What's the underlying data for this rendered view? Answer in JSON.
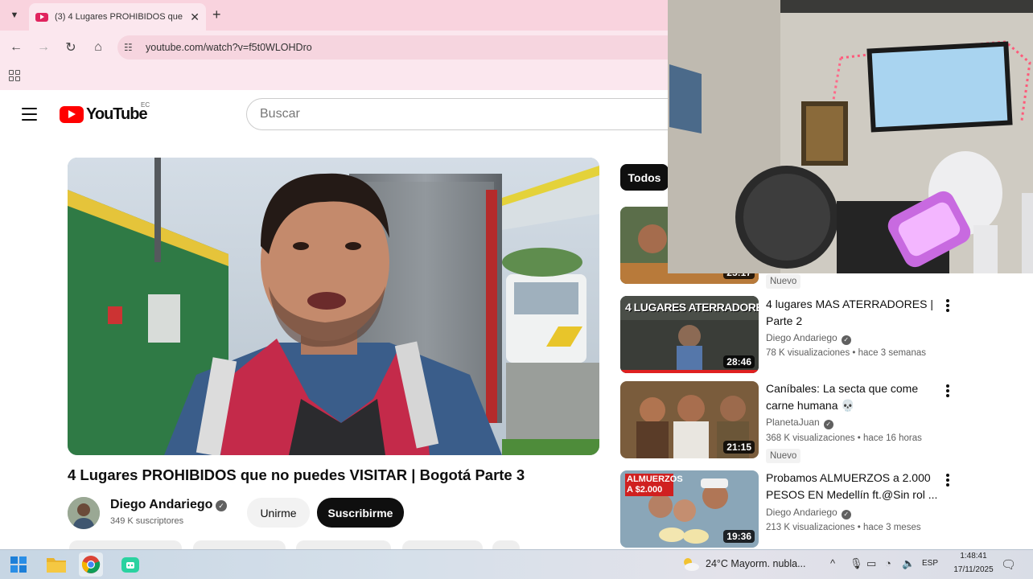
{
  "browser": {
    "tab_title": "(3) 4 Lugares PROHIBIDOS que",
    "tab_close": "✕",
    "new_tab": "+",
    "url": "youtube.com/watch?v=f5t0WLOHDro"
  },
  "youtube": {
    "logo_text": "YouTube",
    "country_code": "EC",
    "search_placeholder": "Buscar",
    "video": {
      "title": "4 Lugares PROHIBIDOS que no puedes VISITAR | Bogotá Parte 3",
      "channel": "Diego Andariego",
      "subscribers": "349 K suscriptores",
      "join_label": "Unirme",
      "subscribe_label": "Suscribirme"
    },
    "chip_all": "Todos",
    "recommendations": [
      {
        "duration": "25:17",
        "badge": "Nuevo"
      },
      {
        "thumb_text": "4 LUGARES ATERRADORES",
        "duration": "28:46",
        "title": "4 lugares MAS ATERRADORES | Parte 2",
        "channel": "Diego Andariego",
        "meta": "78 K visualizaciones • hace 3 semanas"
      },
      {
        "duration": "21:15",
        "title": "Caníbales: La secta que come carne humana 💀",
        "channel": "PlanetaJuan",
        "meta": "368 K visualizaciones • hace 16 horas",
        "badge": "Nuevo"
      },
      {
        "thumb_text": "ALMUERZOS A $2.000",
        "duration": "19:36",
        "title": "Probamos ALMUERZOS a 2.000 PESOS EN Medellín ft.@Sin rol ...",
        "channel": "Diego Andariego",
        "meta": "213 K visualizaciones • hace 3 meses"
      }
    ]
  },
  "taskbar": {
    "weather": "24°C  Mayorm. nubla...",
    "language": "ESP",
    "time": "1:48:41",
    "date": "17/11/2025"
  },
  "colors": {
    "youtube_red": "#ff0000",
    "tab_bar": "#f9d3de",
    "subscribe_bg": "#0f0f0f"
  }
}
